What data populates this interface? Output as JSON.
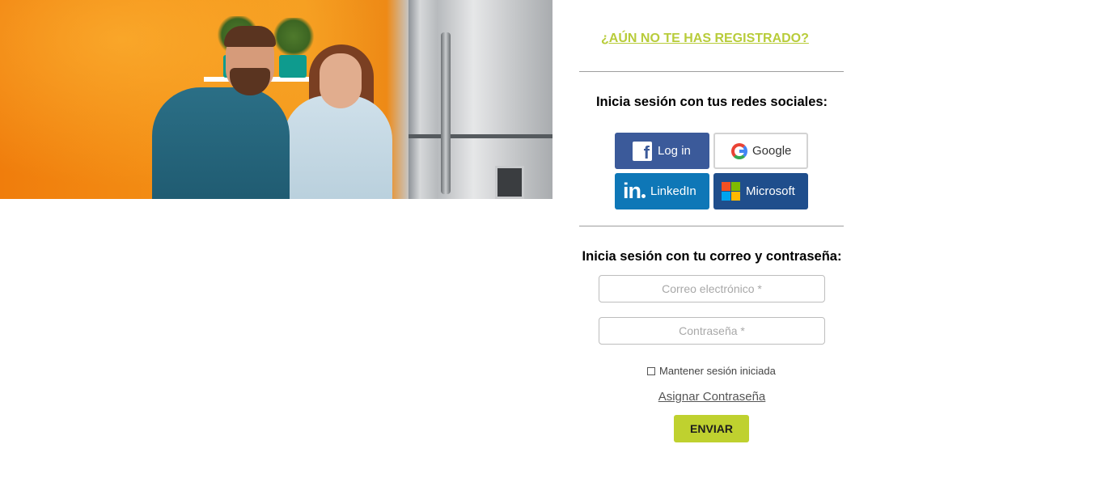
{
  "register": {
    "label": "¿AÚN NO TE HAS REGISTRADO?"
  },
  "social": {
    "heading": "Inicia sesión con tus redes sociales:",
    "buttons": [
      {
        "label": "Log in",
        "icon": "facebook-icon"
      },
      {
        "label": "Google",
        "icon": "google-icon"
      },
      {
        "label": "LinkedIn",
        "icon": "linkedin-icon"
      },
      {
        "label": "Microsoft",
        "icon": "microsoft-icon"
      }
    ],
    "facebook_icon_glyph": "f",
    "linkedin_icon_glyph": "in"
  },
  "login": {
    "heading": "Inicia sesión con tu correo y contraseña:",
    "email_placeholder": "Correo electrónico *",
    "password_placeholder": "Contraseña *",
    "remember_label": "Mantener sesión iniciada",
    "assign_password": "Asignar Contraseña",
    "submit_label": "ENVIAR"
  },
  "colors": {
    "accent": "#bfd12f",
    "register_link": "#b8cc3a",
    "facebook": "#3b5a9a",
    "linkedin": "#0e77b7",
    "microsoft": "#1f4e8c"
  }
}
